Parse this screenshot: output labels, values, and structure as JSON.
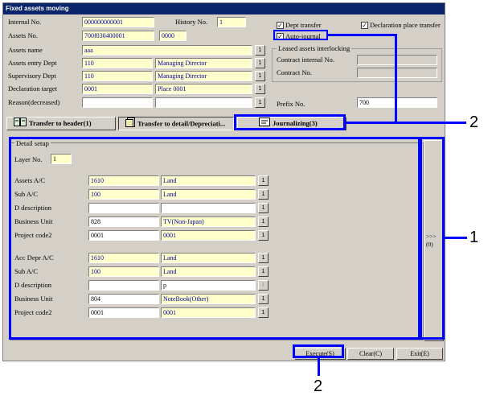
{
  "window": {
    "title": "Fixed assets moving"
  },
  "header": {
    "internal_no_label": "Internal No.",
    "internal_no_value": "000000000001",
    "history_no_label": "History No.",
    "history_no_value": "1",
    "assets_no_label": "Assets No.",
    "assets_no_value": "700f030400001",
    "assets_no_branch": "0000",
    "assets_name_label": "Assets name",
    "assets_name_value": "aaa",
    "entry_dept_label": "Assets entry Dept",
    "entry_dept_code": "110",
    "entry_dept_name": "Managing Director",
    "supervisory_dept_label": "Supervisory Dept",
    "supervisory_dept_code": "110",
    "supervisory_dept_name": "Managing Director",
    "declaration_target_label": "Declaration target",
    "declaration_target_code": "0001",
    "declaration_target_name": "Place 0001",
    "reason_label": "Reason(decreased)",
    "reason_code": "",
    "reason_name": "",
    "lookup_label": "1",
    "dept_transfer_label": "Dept transfer",
    "declaration_place_transfer_label": "Declaration place transfer",
    "auto_journal_label": "Auto-journal",
    "leased_group_title": "Leased assets interlocking",
    "contract_internal_no_label": "Contract internal No.",
    "contract_internal_no_value": "",
    "contract_no_label": "Contract No.",
    "contract_no_value": "",
    "prefix_no_label": "Prefix No.",
    "prefix_no_value": "700"
  },
  "tabs": [
    {
      "label": "Transfer to header(1)"
    },
    {
      "label": "Transfer to detail/Depreciati..."
    },
    {
      "label": "Journalizing(3)"
    }
  ],
  "detail": {
    "group_title": "Detail setup",
    "layer_no_label": "Layer No.",
    "layer_no_value": "1",
    "assets_ac_label": "Assets A/C",
    "assets_ac_code": "1610",
    "assets_ac_name": "Land",
    "sub_ac_label": "Sub A/C",
    "sub_ac_code": "100",
    "sub_ac_name": "Land",
    "d_desc_label": "D description",
    "d_desc_code": "",
    "d_desc_name": "",
    "business_unit_label": "Business Unit",
    "business_unit_code": "828",
    "business_unit_name": "TV(Non-Japan)",
    "project_code2_label": "Project code2",
    "project_code2_code": "0001",
    "project_code2_name": "0001",
    "acc_depr_ac_label": "Acc Depr A/C",
    "acc_depr_ac_code": "1610",
    "acc_depr_ac_name": "Land",
    "sub_ac2_label": "Sub A/C",
    "sub_ac2_code": "100",
    "sub_ac2_name": "Land",
    "d_desc2_label": "D description",
    "d_desc2_code": "",
    "d_desc2_name": "p",
    "business_unit2_label": "Business Unit",
    "business_unit2_code": "804",
    "business_unit2_name": "NoteBook(Other)",
    "project_code2b_label": "Project code2",
    "project_code2b_code": "0001",
    "project_code2b_name": "0001",
    "side_nav_label": ">>>(0)"
  },
  "footer": {
    "execute_label": "Execute(S)",
    "clear_label": "Clear(C)",
    "exit_label": "Exit(E)"
  },
  "callouts": {
    "one": "1",
    "two_top": "2",
    "two_bottom": "2"
  }
}
